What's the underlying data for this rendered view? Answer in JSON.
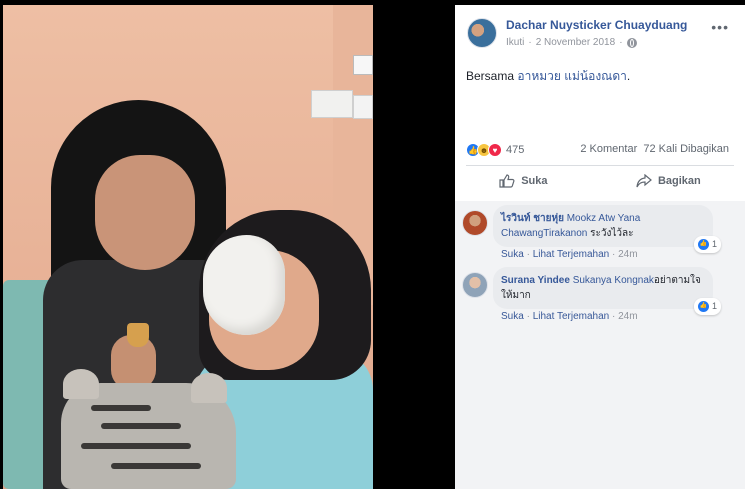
{
  "post": {
    "author": "Dachar Nuysticker Chuayduang",
    "meta_prefix": "Ikuti",
    "date": "2 November 2018",
    "caption_prefix": "Bersama",
    "tag1": "อาหมวย",
    "tag2": "แม่น้องณดา",
    "caption_suffix": ".",
    "more": "•••"
  },
  "stats": {
    "reaction_count": "475",
    "comments": "2 Komentar",
    "shares": "72 Kali Dibagikan"
  },
  "actions": {
    "like_label": "Suka",
    "share_label": "Bagikan"
  },
  "comments": [
    {
      "name": "ไรวินท์ ชายหุ่ย",
      "tag": "Mookz Atw Yana ChawangTirakanon",
      "text": " ระวังไว้ละ",
      "like_count": "1",
      "like_label": "Suka",
      "translate_label": "Lihat Terjemahan",
      "time": "24m"
    },
    {
      "name": "Surana Yindee",
      "tag": "Sukanya Kongnak",
      "text": "อย่าตามใจให้มาก",
      "like_count": "1",
      "like_label": "Suka",
      "translate_label": "Lihat Terjemahan",
      "time": "24m"
    }
  ],
  "colors": {
    "link": "#365899",
    "meta": "#90949c",
    "like_blue": "#2078f4",
    "love_red": "#f0284a",
    "haha_yellow": "#f7c540"
  }
}
